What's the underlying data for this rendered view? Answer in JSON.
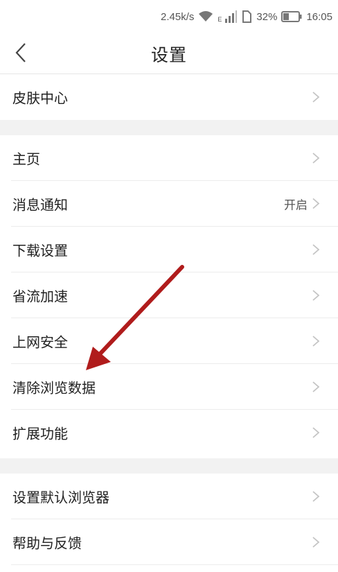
{
  "status_bar": {
    "speed": "2.45k/s",
    "battery_percent": "32%",
    "time": "16:05",
    "network_label": "E",
    "icons": [
      "wifi-icon",
      "signal-icon",
      "sim-icon",
      "battery-icon"
    ]
  },
  "header": {
    "title": "设置",
    "back_icon": "chevron-left-icon"
  },
  "sections": [
    {
      "items": [
        {
          "label": "皮肤中心",
          "value": ""
        }
      ]
    },
    {
      "items": [
        {
          "label": "主页",
          "value": ""
        },
        {
          "label": "消息通知",
          "value": "开启"
        },
        {
          "label": "下载设置",
          "value": ""
        },
        {
          "label": "省流加速",
          "value": ""
        },
        {
          "label": "上网安全",
          "value": ""
        },
        {
          "label": "清除浏览数据",
          "value": ""
        },
        {
          "label": "扩展功能",
          "value": ""
        }
      ]
    },
    {
      "items": [
        {
          "label": "设置默认浏览器",
          "value": ""
        },
        {
          "label": "帮助与反馈",
          "value": ""
        }
      ]
    }
  ],
  "colors": {
    "background": "#ffffff",
    "section_gap": "#f2f2f2",
    "divider": "#ececec",
    "text": "#222222",
    "secondary_text": "#555555",
    "chevron": "#c4c4c4",
    "annotation_arrow": "#b01c1c"
  }
}
